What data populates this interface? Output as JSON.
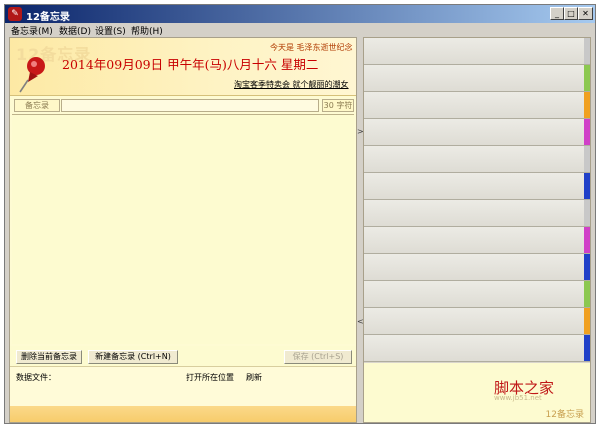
{
  "window": {
    "title": "12备忘录"
  },
  "menu": [
    "备忘录(M)",
    "数据(D)",
    "设置(S)",
    "帮助(H)"
  ],
  "header": {
    "watermark": "12备忘录",
    "today_note": "今天是 毛泽东逝世纪念",
    "date_line": "2014年09月09日  甲午年(马)八月十六  星期二",
    "link": "淘宝客季特卖会 就个靓丽的潮女"
  },
  "editor": {
    "subject_label": "备忘录",
    "subject_value": "",
    "char_count": "30 字符"
  },
  "buttons": {
    "delete": "删除当前备忘录",
    "new": "新建备忘录 (Ctrl+N)",
    "save": "保存 (Ctrl+S)"
  },
  "datafile": {
    "label": "数据文件：",
    "open_location": "打开所在位置",
    "refresh": "刷新"
  },
  "notes_tags": [
    "#c8c8c8",
    "#8cc850",
    "#f0a020",
    "#d040c8",
    "#c8c8c8",
    "#2040c8",
    "#c8c8c8",
    "#d040c8",
    "#2040c8",
    "#8cc850",
    "#f0a020",
    "#2040c8"
  ],
  "right_footer": {
    "logo": "脚本之家",
    "url": "www.jb51.net",
    "app_label": "12备忘录"
  }
}
